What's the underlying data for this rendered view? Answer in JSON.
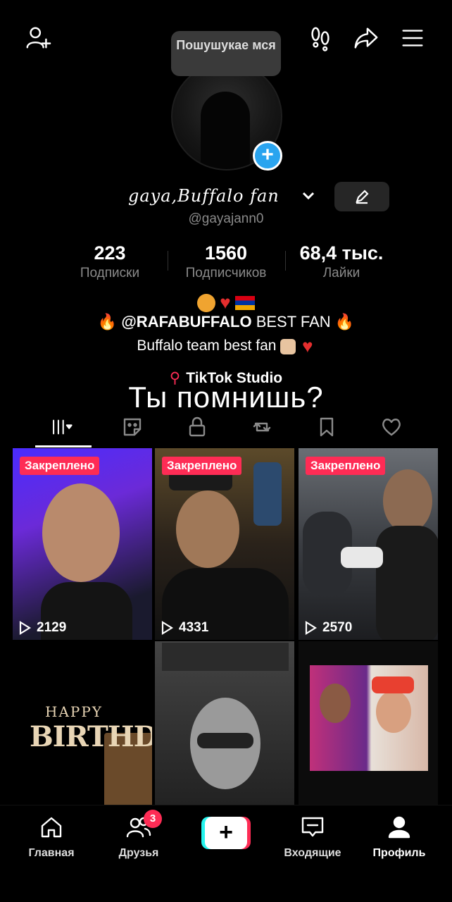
{
  "tooltip": {
    "text": "Пошушукае мся"
  },
  "profile": {
    "display_name": "gaya,Buffalo fan",
    "username": "@gayajann0"
  },
  "stats": [
    {
      "value": "223",
      "label": "Подписки"
    },
    {
      "value": "1560",
      "label": "Подписчиков"
    },
    {
      "value": "68,4 тыс.",
      "label": "Лайки"
    }
  ],
  "bio": {
    "line2_mention": "@RAFABUFFALO",
    "line2_text": " BEST FAN ",
    "line3_text": "Buffalo team best fan "
  },
  "studio": {
    "label": "TikTok Studio"
  },
  "overlay_caption": "Ты помнишь?",
  "tabs": [
    "videos-tab",
    "reposts-tab",
    "private-tab",
    "repost-tab",
    "saved-tab",
    "liked-tab"
  ],
  "videos": [
    {
      "pinned_label": "Закреплено",
      "views": "2129"
    },
    {
      "pinned_label": "Закреплено",
      "views": "4331"
    },
    {
      "pinned_label": "Закреплено",
      "views": "2570"
    }
  ],
  "tile4": {
    "small": "HAPPY",
    "big": "BIRTHDAY"
  },
  "nav": {
    "home": "Главная",
    "friends": "Друзья",
    "friends_badge": "3",
    "create": "+",
    "inbox": "Входящие",
    "profile": "Профиль"
  },
  "colors": {
    "accent": "#fe2c55",
    "cyan": "#25f4ee",
    "blue_add": "#2aa4ef"
  }
}
